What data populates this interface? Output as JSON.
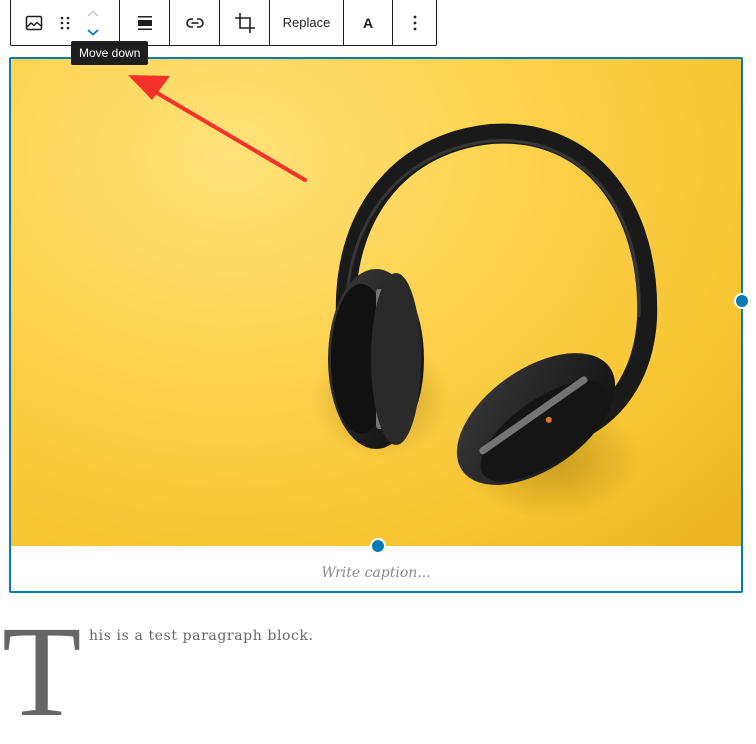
{
  "toolbar": {
    "items": [
      {
        "name": "image-block-type",
        "icon": "image-icon"
      },
      {
        "name": "drag-handle",
        "icon": "drag-icon"
      },
      {
        "name": "move-up",
        "icon": "chevron-up-icon"
      },
      {
        "name": "move-down",
        "icon": "chevron-down-icon"
      },
      {
        "name": "align",
        "icon": "align-full-icon"
      },
      {
        "name": "insert-link",
        "icon": "link-icon"
      },
      {
        "name": "crop",
        "icon": "crop-icon"
      },
      {
        "name": "replace",
        "label": "Replace"
      },
      {
        "name": "text-overlay",
        "label": "A"
      },
      {
        "name": "more-options",
        "icon": "more-vertical-icon"
      }
    ],
    "replace_label": "Replace",
    "text_label": "A"
  },
  "tooltip": {
    "text": "Move down"
  },
  "image_block": {
    "image_description": "Black over-ear headphones on a yellow background",
    "caption_placeholder": "Write caption..."
  },
  "paragraph": {
    "dropcap": "T",
    "text": "his is a test paragraph block."
  },
  "colors": {
    "accent": "#0a7ab5",
    "annotation_arrow": "#f5322a",
    "tooltip_bg": "#1e1e1e"
  }
}
